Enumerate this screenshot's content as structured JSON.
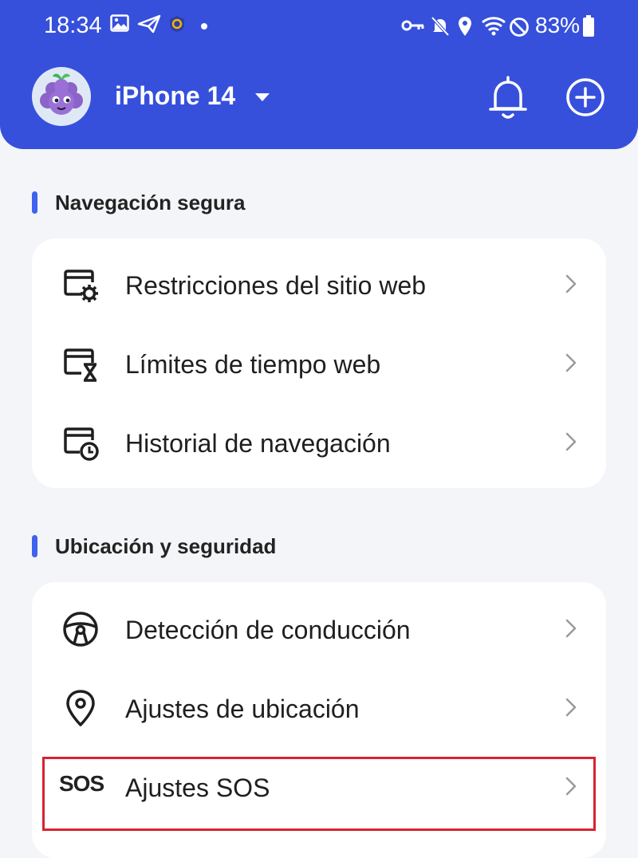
{
  "status_bar": {
    "time": "18:34",
    "battery": "83%"
  },
  "header": {
    "device_name": "iPhone 14"
  },
  "sections": [
    {
      "title": "Navegación segura",
      "items": [
        {
          "label": "Restricciones del sitio web",
          "icon": "browser-gear-icon"
        },
        {
          "label": "Límites de tiempo web",
          "icon": "browser-hourglass-icon"
        },
        {
          "label": "Historial de navegación",
          "icon": "browser-clock-icon"
        }
      ]
    },
    {
      "title": "Ubicación y seguridad",
      "items": [
        {
          "label": "Detección de conducción",
          "icon": "steering-wheel-icon"
        },
        {
          "label": "Ajustes de ubicación",
          "icon": "location-pin-icon"
        },
        {
          "label": "Ajustes SOS",
          "icon": "sos-icon",
          "icon_text": "SOS",
          "highlighted": true
        }
      ]
    }
  ],
  "colors": {
    "header_bg": "#3650dc",
    "accent_bar": "#3f62ef",
    "highlight_border": "#d9232f",
    "page_bg": "#f4f5f8"
  }
}
